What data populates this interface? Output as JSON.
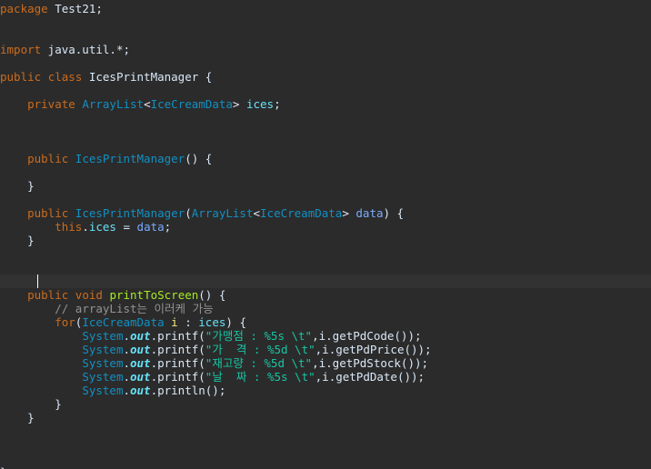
{
  "editor": {
    "language": "java",
    "colors": {
      "background": "#2b2b2b",
      "current_line": "#323232",
      "keyword": "#cc6c1d",
      "type": "#1290c3",
      "field": "#66e1f8",
      "string": "#17c6a3",
      "comment": "#939393",
      "method": "#a7ec21",
      "plain": "#d9e8f7"
    },
    "cursor": {
      "line": 20,
      "column": 5
    },
    "lines": [
      [
        {
          "t": "package",
          "c": "keyword"
        },
        {
          "t": " Test21;",
          "c": "plain"
        }
      ],
      [],
      [],
      [
        {
          "t": "import",
          "c": "keyword"
        },
        {
          "t": " java.util.*;",
          "c": "plain"
        }
      ],
      [],
      [
        {
          "t": "public",
          "c": "keyword"
        },
        {
          "t": " ",
          "c": "plain"
        },
        {
          "t": "class",
          "c": "keyword"
        },
        {
          "t": " IcesPrintManager {",
          "c": "plain"
        }
      ],
      [],
      [
        {
          "t": "    ",
          "c": "plain"
        },
        {
          "t": "private",
          "c": "keyword"
        },
        {
          "t": " ",
          "c": "plain"
        },
        {
          "t": "ArrayList",
          "c": "type"
        },
        {
          "t": "<",
          "c": "punct"
        },
        {
          "t": "IceCreamData",
          "c": "type"
        },
        {
          "t": "> ",
          "c": "punct"
        },
        {
          "t": "ices",
          "c": "field"
        },
        {
          "t": ";",
          "c": "plain"
        }
      ],
      [],
      [],
      [],
      [
        {
          "t": "    ",
          "c": "plain"
        },
        {
          "t": "public",
          "c": "keyword"
        },
        {
          "t": " ",
          "c": "plain"
        },
        {
          "t": "IcesPrintManager",
          "c": "type"
        },
        {
          "t": "() {",
          "c": "plain"
        }
      ],
      [],
      [
        {
          "t": "    }",
          "c": "plain"
        }
      ],
      [],
      [
        {
          "t": "    ",
          "c": "plain"
        },
        {
          "t": "public",
          "c": "keyword"
        },
        {
          "t": " ",
          "c": "plain"
        },
        {
          "t": "IcesPrintManager",
          "c": "type"
        },
        {
          "t": "(",
          "c": "plain"
        },
        {
          "t": "ArrayList",
          "c": "type"
        },
        {
          "t": "<",
          "c": "punct"
        },
        {
          "t": "IceCreamData",
          "c": "type"
        },
        {
          "t": "> ",
          "c": "punct"
        },
        {
          "t": "data",
          "c": "param"
        },
        {
          "t": ") {",
          "c": "plain"
        }
      ],
      [
        {
          "t": "        ",
          "c": "plain"
        },
        {
          "t": "this",
          "c": "keyword"
        },
        {
          "t": ".",
          "c": "plain"
        },
        {
          "t": "ices",
          "c": "field"
        },
        {
          "t": " = ",
          "c": "plain"
        },
        {
          "t": "data",
          "c": "param"
        },
        {
          "t": ";",
          "c": "plain"
        }
      ],
      [
        {
          "t": "    }",
          "c": "plain"
        }
      ],
      [],
      [],
      [
        {
          "t": "    ",
          "c": "plain"
        }
      ],
      [
        {
          "t": "    ",
          "c": "plain"
        },
        {
          "t": "public",
          "c": "keyword"
        },
        {
          "t": " ",
          "c": "plain"
        },
        {
          "t": "void",
          "c": "keyword"
        },
        {
          "t": " ",
          "c": "plain"
        },
        {
          "t": "printToScreen",
          "c": "method"
        },
        {
          "t": "() {",
          "c": "plain"
        }
      ],
      [
        {
          "t": "        ",
          "c": "plain"
        },
        {
          "t": "// arrayList는 이러케 가능",
          "c": "comment"
        }
      ],
      [
        {
          "t": "        ",
          "c": "plain"
        },
        {
          "t": "for",
          "c": "keyword"
        },
        {
          "t": "(",
          "c": "plain"
        },
        {
          "t": "IceCreamData",
          "c": "type"
        },
        {
          "t": " ",
          "c": "plain"
        },
        {
          "t": "i",
          "c": "local"
        },
        {
          "t": " : ",
          "c": "plain"
        },
        {
          "t": "ices",
          "c": "field"
        },
        {
          "t": ") {",
          "c": "plain"
        }
      ],
      [
        {
          "t": "            ",
          "c": "plain"
        },
        {
          "t": "System",
          "c": "classref"
        },
        {
          "t": ".",
          "c": "plain"
        },
        {
          "t": "out",
          "c": "static"
        },
        {
          "t": ".printf(",
          "c": "plain"
        },
        {
          "t": "\"가맹점 : %5s \\t\"",
          "c": "string"
        },
        {
          "t": ",i.getPdCode());",
          "c": "plain"
        }
      ],
      [
        {
          "t": "            ",
          "c": "plain"
        },
        {
          "t": "System",
          "c": "classref"
        },
        {
          "t": ".",
          "c": "plain"
        },
        {
          "t": "out",
          "c": "static"
        },
        {
          "t": ".printf(",
          "c": "plain"
        },
        {
          "t": "\"가  격 : %5d \\t\"",
          "c": "string"
        },
        {
          "t": ",i.getPdPrice());",
          "c": "plain"
        }
      ],
      [
        {
          "t": "            ",
          "c": "plain"
        },
        {
          "t": "System",
          "c": "classref"
        },
        {
          "t": ".",
          "c": "plain"
        },
        {
          "t": "out",
          "c": "static"
        },
        {
          "t": ".printf(",
          "c": "plain"
        },
        {
          "t": "\"재고량 : %5d \\t\"",
          "c": "string"
        },
        {
          "t": ",i.getPdStock());",
          "c": "plain"
        }
      ],
      [
        {
          "t": "            ",
          "c": "plain"
        },
        {
          "t": "System",
          "c": "classref"
        },
        {
          "t": ".",
          "c": "plain"
        },
        {
          "t": "out",
          "c": "static"
        },
        {
          "t": ".printf(",
          "c": "plain"
        },
        {
          "t": "\"날  짜 : %5s \\t\"",
          "c": "string"
        },
        {
          "t": ",i.getPdDate());",
          "c": "plain"
        }
      ],
      [
        {
          "t": "            ",
          "c": "plain"
        },
        {
          "t": "System",
          "c": "classref"
        },
        {
          "t": ".",
          "c": "plain"
        },
        {
          "t": "out",
          "c": "static"
        },
        {
          "t": ".println();",
          "c": "plain"
        }
      ],
      [
        {
          "t": "        }",
          "c": "plain"
        }
      ],
      [
        {
          "t": "    }",
          "c": "plain"
        }
      ],
      [],
      [],
      [],
      [
        {
          "t": "}",
          "c": "plain"
        }
      ]
    ]
  }
}
